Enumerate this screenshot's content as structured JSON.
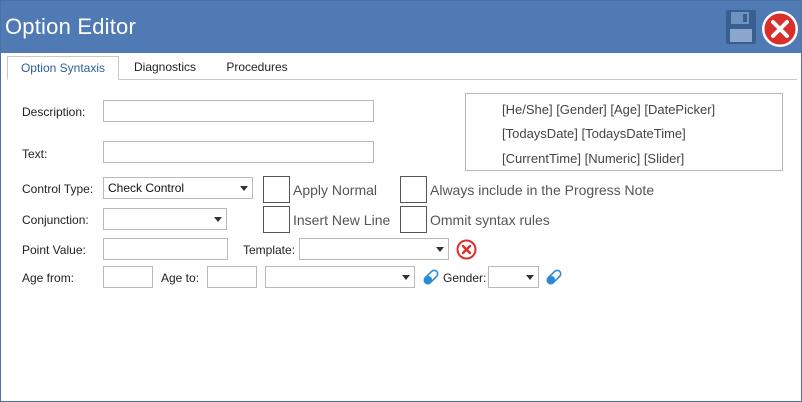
{
  "window": {
    "title": "Option Editor"
  },
  "tabs": [
    {
      "label": "Option Syntaxis",
      "active": true
    },
    {
      "label": "Diagnostics",
      "active": false
    },
    {
      "label": "Procedures",
      "active": false
    }
  ],
  "form": {
    "description_label": "Description:",
    "description_value": "",
    "text_label": "Text:",
    "text_value": "",
    "control_type_label": "Control Type:",
    "control_type_value": "Check Control",
    "conjunction_label": "Conjunction:",
    "conjunction_value": "",
    "point_value_label": "Point Value:",
    "point_value_value": "",
    "template_label": "Template:",
    "template_value": "",
    "age_from_label": "Age from:",
    "age_from_value": "",
    "age_to_label": "Age to:",
    "age_to_value": "",
    "age_unit_value": "",
    "gender_label": "Gender:",
    "gender_value": ""
  },
  "checkboxes": {
    "apply_normal": {
      "label": "Apply Normal",
      "checked": false
    },
    "always_include": {
      "label": "Always include in the Progress Note",
      "checked": false
    },
    "insert_new_line": {
      "label": "Insert New Line",
      "checked": false
    },
    "ommit_syntax": {
      "label": "Ommit syntax rules",
      "checked": false
    }
  },
  "tokens": {
    "line1": "[He/She]  [Gender]  [Age]  [DatePicker]",
    "line2": "[TodaysDate]  [TodaysDateTime]",
    "line3": "[CurrentTime]  [Numeric]  [Slider]"
  },
  "icons": {
    "save": "floppy-disk-icon",
    "close": "close-icon",
    "clear_template": "clear-icon",
    "eraser": "eraser-icon"
  },
  "colors": {
    "titlebar": "#4f7ab3",
    "close_red": "#d9302c",
    "eraser_blue": "#2a8ad4",
    "tab_active_text": "#2b5f9f"
  }
}
